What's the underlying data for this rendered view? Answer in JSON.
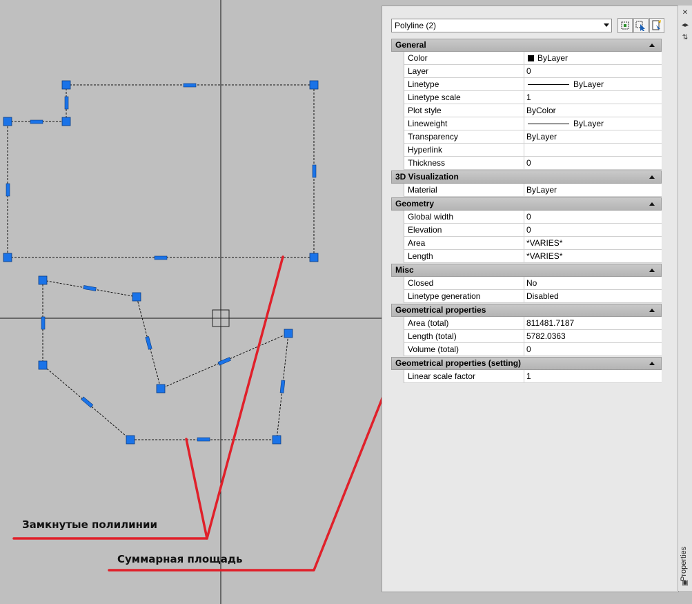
{
  "annotations": {
    "closed_polylines": "Замкнутые полилинии",
    "total_area": "Суммарная площадь"
  },
  "colors": {
    "canvas_bg": "#bfbfbf",
    "grip": "#1a73e8",
    "annotation_line": "#e0202a",
    "palette_bg": "#e8e8e8"
  },
  "palette": {
    "selected_object": "Polyline (2)",
    "toolbar": [
      "select-objects-icon",
      "quick-select-icon",
      "toggle-pickadd-icon"
    ],
    "side_title": "Properties",
    "categories": [
      {
        "title": "General",
        "rows": [
          {
            "name": "Color",
            "value": "ByLayer",
            "swatch": "#000000"
          },
          {
            "name": "Layer",
            "value": "0"
          },
          {
            "name": "Linetype",
            "value": "ByLayer",
            "line_sample": true
          },
          {
            "name": "Linetype scale",
            "value": "1"
          },
          {
            "name": "Plot style",
            "value": "ByColor"
          },
          {
            "name": "Lineweight",
            "value": "ByLayer",
            "line_sample": true
          },
          {
            "name": "Transparency",
            "value": "ByLayer"
          },
          {
            "name": "Hyperlink",
            "value": ""
          },
          {
            "name": "Thickness",
            "value": "0"
          }
        ]
      },
      {
        "title": "3D Visualization",
        "rows": [
          {
            "name": "Material",
            "value": "ByLayer"
          }
        ]
      },
      {
        "title": "Geometry",
        "rows": [
          {
            "name": "Global width",
            "value": "0"
          },
          {
            "name": "Elevation",
            "value": "0"
          },
          {
            "name": "Area",
            "value": "*VARIES*"
          },
          {
            "name": "Length",
            "value": "*VARIES*"
          }
        ]
      },
      {
        "title": "Misc",
        "rows": [
          {
            "name": "Closed",
            "value": "No"
          },
          {
            "name": "Linetype generation",
            "value": "Disabled"
          }
        ]
      },
      {
        "title": "Geometrical properties",
        "rows": [
          {
            "name": "Area (total)",
            "value": "811481.7187"
          },
          {
            "name": "Length (total)",
            "value": "5782.0363"
          },
          {
            "name": "Volume (total)",
            "value": "0"
          }
        ]
      },
      {
        "title": "Geometrical properties (setting)",
        "rows": [
          {
            "name": "Linear scale factor",
            "value": "1"
          }
        ]
      }
    ]
  }
}
